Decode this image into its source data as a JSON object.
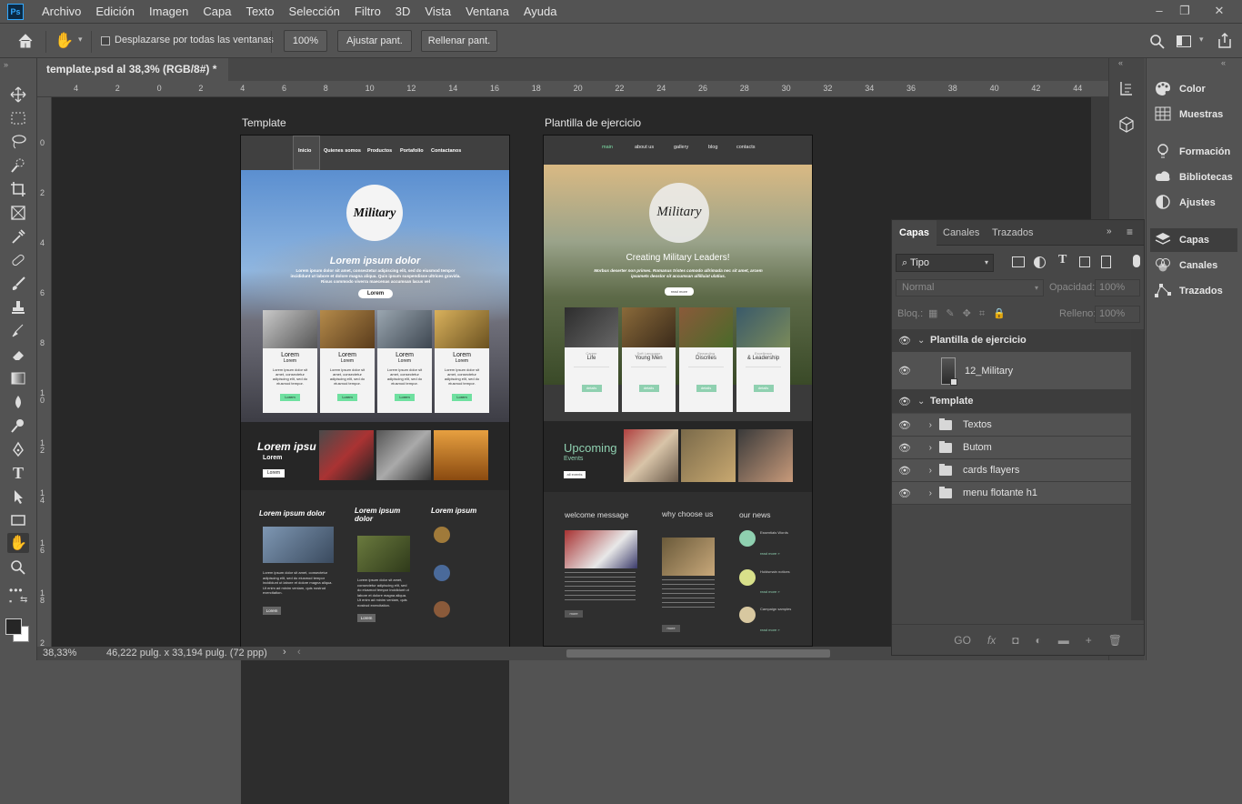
{
  "app": {
    "logo": "Ps",
    "menu": [
      "Archivo",
      "Edición",
      "Imagen",
      "Capa",
      "Texto",
      "Selección",
      "Filtro",
      "3D",
      "Vista",
      "Ventana",
      "Ayuda"
    ]
  },
  "options": {
    "scroll_all_label": "Desplazarse por todas las ventanas",
    "zoom_100": "100%",
    "fit_screen": "Ajustar pant.",
    "fill_screen": "Rellenar pant."
  },
  "document": {
    "tab_title": "template.psd al 38,3% (RGB/8#) *",
    "close": "×"
  },
  "ruler": {
    "top": [
      "4",
      "2",
      "0",
      "2",
      "4",
      "6",
      "8",
      "10",
      "12",
      "14",
      "16",
      "18",
      "20",
      "22",
      "24",
      "26",
      "28",
      "30",
      "32",
      "34",
      "36",
      "38",
      "40",
      "42",
      "44"
    ],
    "left": [
      "0",
      "2",
      "4",
      "6",
      "8",
      "1\n0",
      "1\n2",
      "1\n4",
      "1\n6",
      "1\n8",
      "2\n0"
    ]
  },
  "canvas": {
    "template_label": "Template",
    "exercise_label": "Plantilla de ejercicio",
    "template_nav": [
      "Inicio",
      "Quienes somos",
      "Productos",
      "Portafolio",
      "Contactanos"
    ],
    "template_logo": "Military",
    "template_hero_title": "Lorem ipsum dolor",
    "template_hero_text": "Lorem ipsum dolor sit amet, consectetur adipiscing elit, sed do eiusmod tempor incididunt ut labore et dolore magna aliqua. Quis ipsum suspendisse ultrices gravida. Risus commodo viverra maecenas accumsan lacus vel",
    "template_hero_btn": "Lorem",
    "template_cards": [
      {
        "t1": "Lorem",
        "t2": "Lorem"
      },
      {
        "t1": "Lorem",
        "t2": "Lorem"
      },
      {
        "t1": "Lorem",
        "t2": "Lorem"
      },
      {
        "t1": "Lorem",
        "t2": "Lorem"
      }
    ],
    "template_card_text": "Lorem ipsum dolor sit amet, consectetur adipiscing elit, sed do eiusmod tempor.",
    "template_card_btn": "Lorem",
    "template_band_title": "Lorem ipsu",
    "template_band_sub": "Lorem",
    "template_band_btn": "Lorem",
    "template_col_titles": [
      "Lorem ipsum dolor",
      "Lorem ipsum dolor",
      "Lorem ipsum"
    ],
    "template_col_text": "Lorem ipsum dolor sit amet, consectetur adipiscing elit, sed do eiusmod tempor incididunt ut labore et dolore magna aliqua. Ut enim ad minim veniam, quis nostrud exercitation.",
    "template_col_btn": "Lorem",
    "exercise_nav": [
      "main",
      "about us",
      "gallery",
      "blog",
      "contacts"
    ],
    "exercise_logo": "Military",
    "exercise_hero_title": "Creating Military Leaders!",
    "exercise_hero_text": "Morbus deserter non primes. Romanus tristes comodo ullrimada nec sit amet, arcem ipsamets deoslor sit accumsan ullilluiat ulatius.",
    "exercise_hero_btn": "read more",
    "exercise_cards": [
      {
        "t1": "Career",
        "t2": "Life"
      },
      {
        "t1": "Soft Language",
        "t2": "Young Men"
      },
      {
        "t1": "Rewarding",
        "t2": "Discriles"
      },
      {
        "t1": "Excellence",
        "t2": "& Leadership"
      }
    ],
    "exercise_card_btn": "details",
    "exercise_band_title": "Upcoming",
    "exercise_band_sub": "Events",
    "exercise_band_btn": "all events",
    "exercise_col_titles": [
      "welcome message",
      "why choose us",
      "our news"
    ],
    "exercise_col_btn": "more",
    "exercise_news": [
      {
        "t": "Essentials Words",
        "d": "read more »"
      },
      {
        "t": "Holdsmain notices",
        "d": "read more »"
      },
      {
        "t": "Campaign samples",
        "d": "read more »"
      }
    ]
  },
  "status": {
    "zoom": "38,33%",
    "doc_size": "46,222 pulg. x 33,194 pulg. (72 ppp)"
  },
  "right_panel": {
    "items": [
      "Color",
      "Muestras",
      "Formación",
      "Bibliotecas",
      "Ajustes",
      "Capas",
      "Canales",
      "Trazados"
    ]
  },
  "layers_panel": {
    "tabs": [
      "Capas",
      "Canales",
      "Trazados"
    ],
    "filter": "Tipo",
    "blend_mode": "Normal",
    "opacity_label": "Opacidad:",
    "opacity": "100%",
    "lock_label": "Bloq.:",
    "fill_label": "Relleno:",
    "fill": "100%",
    "layers": [
      {
        "name": "Plantilla de ejercicio",
        "type": "group-open"
      },
      {
        "name": "12_Military",
        "type": "smart"
      },
      {
        "name": "Template",
        "type": "group-open"
      },
      {
        "name": "Textos",
        "type": "group"
      },
      {
        "name": "Butom",
        "type": "group"
      },
      {
        "name": "cards flayers",
        "type": "group"
      },
      {
        "name": "menu flotante h1",
        "type": "group"
      }
    ],
    "footer": [
      "GO",
      "fx",
      "◘",
      "◐",
      "▬",
      "+",
      "🗑"
    ]
  }
}
